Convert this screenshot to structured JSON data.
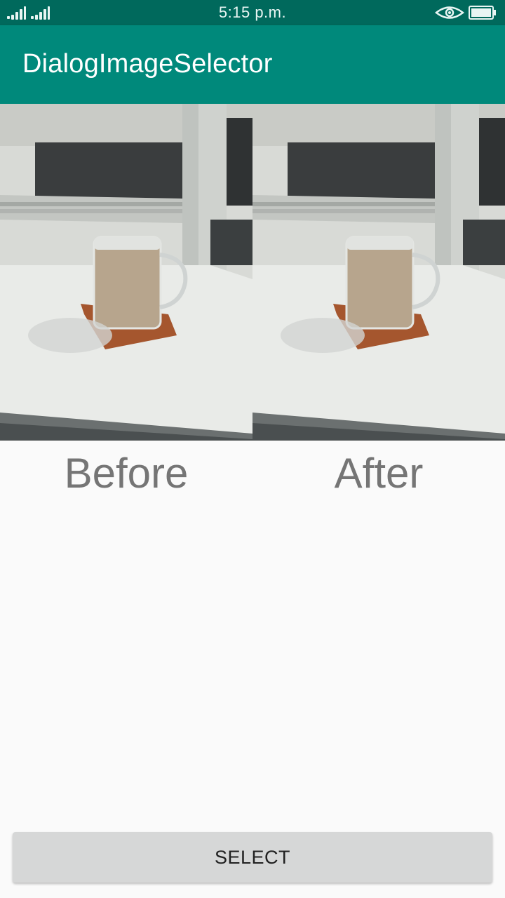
{
  "status_bar": {
    "time": "5:15 p.m.",
    "icons": [
      "signal-icon",
      "signal-icon",
      "eye-icon",
      "battery-icon"
    ]
  },
  "app_bar": {
    "title": "DialogImageSelector",
    "color": "#00897b",
    "status_color": "#00695c"
  },
  "images": {
    "before": {
      "label": "Before",
      "content": "photo-coffee-mug"
    },
    "after": {
      "label": "After",
      "content": "photo-coffee-mug"
    }
  },
  "actions": {
    "select_label": "SELECT"
  }
}
